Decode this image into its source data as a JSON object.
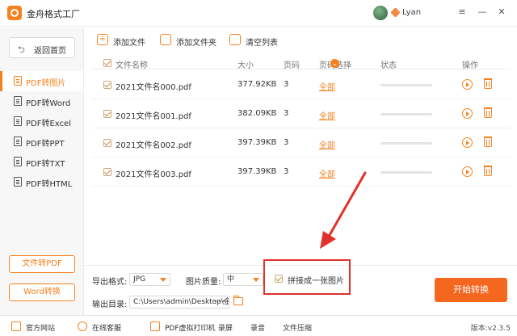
{
  "app": {
    "title": "金舟格式工厂",
    "username": "Lyan",
    "version": "版本:v2.3.5"
  },
  "sidebar": {
    "home_label": "返回首页",
    "items": [
      {
        "label": "PDF转图片",
        "active": true
      },
      {
        "label": "PDF转Word",
        "active": false
      },
      {
        "label": "PDF转Excel",
        "active": false
      },
      {
        "label": "PDF转PPT",
        "active": false
      },
      {
        "label": "PDF转TXT",
        "active": false
      },
      {
        "label": "PDF转HTML",
        "active": false
      }
    ],
    "file_to_pdf": "文件转PDF",
    "word_convert": "Word转换"
  },
  "toolbar": {
    "add_file": "添加文件",
    "add_folder": "添加文件夹",
    "clear_list": "清空列表"
  },
  "table": {
    "headers": {
      "name": "文件名称",
      "size": "大小",
      "pages": "页码",
      "page_select": "页码选择",
      "status": "状态",
      "ops": "操作"
    },
    "rows": [
      {
        "name": "2021文件名000.pdf",
        "size": "377.92KB",
        "pages": "3",
        "select": "全部",
        "progress": 0
      },
      {
        "name": "2021文件名001.pdf",
        "size": "382.09KB",
        "pages": "3",
        "select": "全部",
        "progress": 0
      },
      {
        "name": "2021文件名002.pdf",
        "size": "397.39KB",
        "pages": "3",
        "select": "全部",
        "progress": 0
      },
      {
        "name": "2021文件名003.pdf",
        "size": "397.39KB",
        "pages": "3",
        "select": "全部",
        "progress": 0
      }
    ]
  },
  "settings": {
    "format_label": "导出格式:",
    "format_value": "JPG",
    "quality_label": "图片质量:",
    "quality_value": "中",
    "merge_label": "拼接成一张图片",
    "merge_checked": true,
    "output_label": "输出目录:",
    "output_path": "C:\\Users\\admin\\Desktop\\金",
    "more": "•••",
    "start_button": "开始转换"
  },
  "statusbar": {
    "website": "官方网站",
    "service": "在线客服",
    "printer": "PDF虚拟打印机",
    "screen": "录屏",
    "audio": "录音",
    "compress": "文件压缩"
  },
  "colors": {
    "accent": "#f5821f",
    "start_button": "#f5661f",
    "annotation": "#e0312b"
  }
}
